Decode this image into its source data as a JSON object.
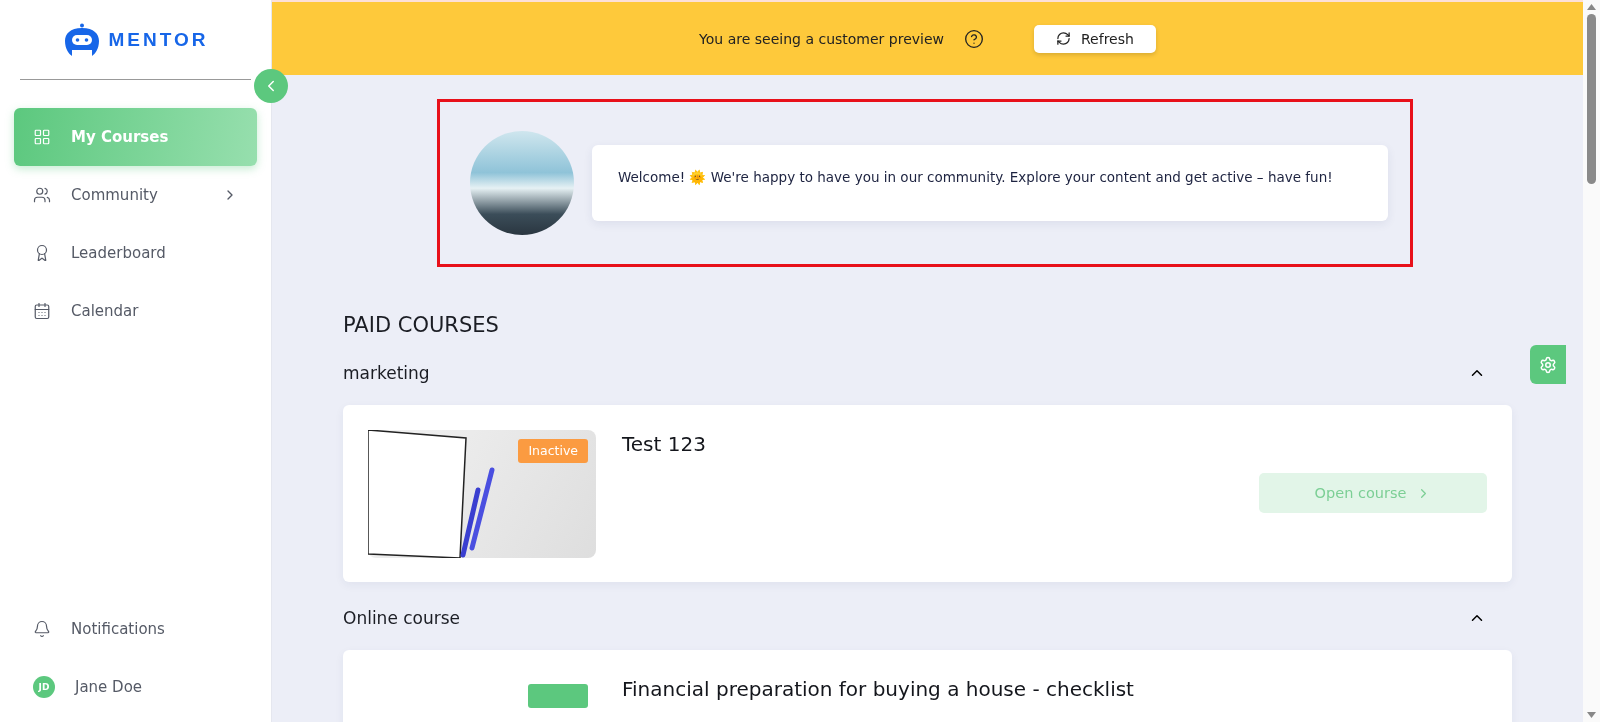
{
  "brand": {
    "name": "MENTOR"
  },
  "sidebar": {
    "items": [
      {
        "label": "My Courses",
        "kind": "courses",
        "selected": true,
        "expandable": false
      },
      {
        "label": "Community",
        "kind": "community",
        "selected": false,
        "expandable": true
      },
      {
        "label": "Leaderboard",
        "kind": "leaderboard",
        "selected": false,
        "expandable": false
      },
      {
        "label": "Calendar",
        "kind": "calendar",
        "selected": false,
        "expandable": false
      }
    ],
    "bottom_items": [
      {
        "label": "Notifications",
        "kind": "notifications"
      },
      {
        "label": "Jane Doe",
        "kind": "user",
        "initials": "JD"
      }
    ]
  },
  "preview_banner": {
    "text": "You are seeing a customer preview",
    "button": "Refresh"
  },
  "welcome": {
    "message": "Welcome! 🌞 We're happy to have you in our community. Explore your content and get active – have fun!",
    "highlighted": true
  },
  "section_title": "PAID COURSES",
  "groups": [
    {
      "name": "marketing",
      "expanded": true,
      "courses": [
        {
          "title": "Test 123",
          "badge": {
            "label": "Inactive",
            "color": "#fb9b41"
          },
          "button": "Open course",
          "kind": "photo"
        }
      ]
    },
    {
      "name": "Online course",
      "expanded": true,
      "courses": [
        {
          "title": "Financial preparation for buying a house - checklist",
          "badge": {
            "color": "#5cc87e"
          },
          "kind": "empty"
        }
      ]
    }
  ]
}
